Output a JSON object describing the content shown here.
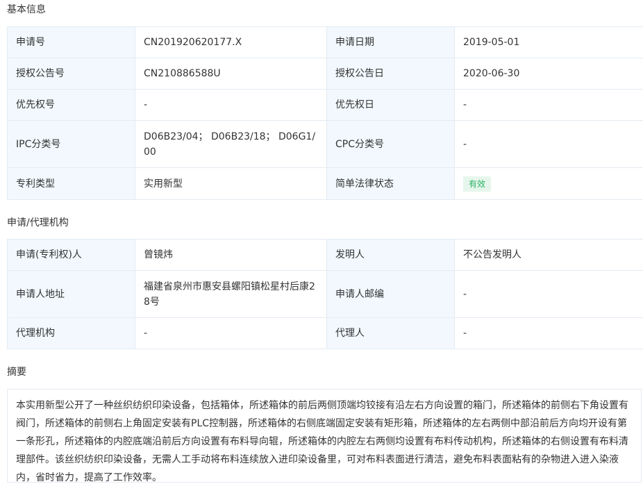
{
  "basic_info": {
    "title": "基本信息",
    "rows": [
      {
        "l1": "申请号",
        "v1": "CN201920620177.X",
        "l2": "申请日期",
        "v2": "2019-05-01"
      },
      {
        "l1": "授权公告号",
        "v1": "CN210886588U",
        "l2": "授权公告日",
        "v2": "2020-06-30"
      },
      {
        "l1": "优先权号",
        "v1": "-",
        "l2": "优先权日",
        "v2": "-"
      },
      {
        "l1": "IPC分类号",
        "v1": "D06B23/04； D06B23/18； D06G1/00",
        "l2": "CPC分类号",
        "v2": "-"
      },
      {
        "l1": "专利类型",
        "v1": "实用新型",
        "l2": "简单法律状态",
        "v2": "有效"
      }
    ]
  },
  "agency": {
    "title": "申请/代理机构",
    "rows": [
      {
        "l1": "申请(专利权)人",
        "v1": "曾镜炜",
        "l2": "发明人",
        "v2": "不公告发明人"
      },
      {
        "l1": "申请人地址",
        "v1": "福建省泉州市惠安县螺阳镇松星村后康28号",
        "l2": "申请人邮编",
        "v2": "-"
      },
      {
        "l1": "代理机构",
        "v1": "-",
        "l2": "代理人",
        "v2": "-"
      }
    ]
  },
  "abstract": {
    "title": "摘要",
    "text": "本实用新型公开了一种丝织纺织印染设备，包括箱体，所述箱体的前后两侧顶端均铰接有沿左右方向设置的箱门，所述箱体的前侧右下角设置有阀门，所述箱体的前侧右上角固定安装有PLC控制器，所述箱体的右侧底端固定安装有矩形箱，所述箱体的左右两侧中部沿前后方向均开设有第一条形孔，所述箱体的内腔底端沿前后方向设置有布料导向辊，所述箱体的内腔左右两侧均设置有布料传动机构，所述箱体的右侧设置有布料清理部件。该丝织纺织印染设备，无需人工手动将布料连续放入进印染设备里，可对布料表面进行清洁，避免布料表面粘有的杂物进入进入染液内，省时省力，提高了工作效率。"
  },
  "colors": {
    "label_bg": "#f2f8fe",
    "border": "#e4ebf2",
    "status_green": "#28b463"
  }
}
